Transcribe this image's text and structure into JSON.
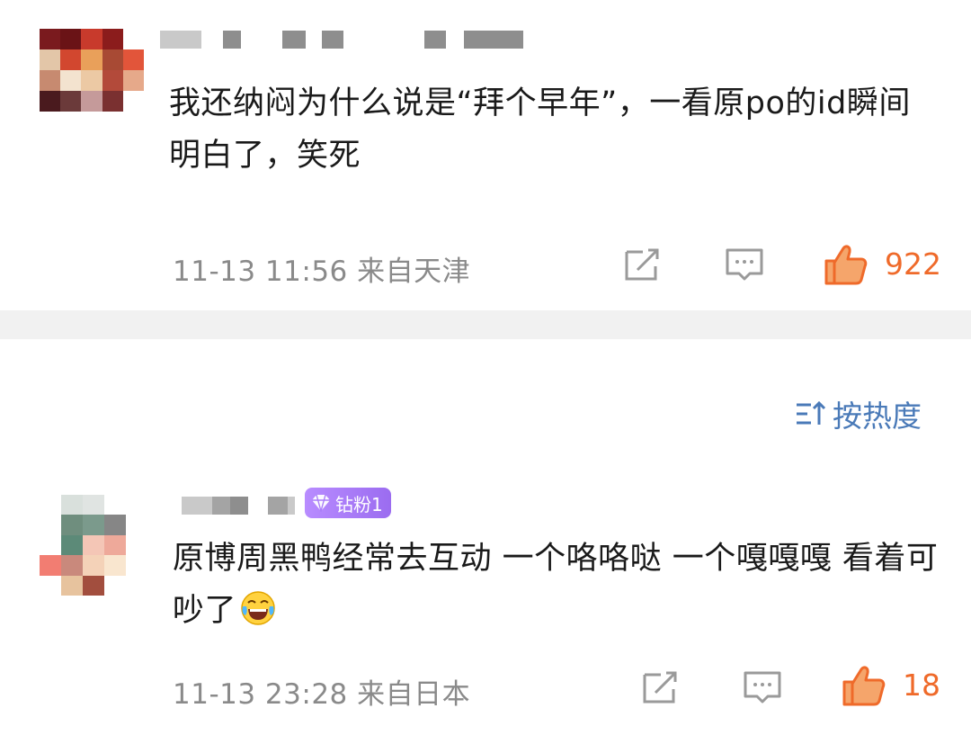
{
  "comments": [
    {
      "text": "我还纳闷为什么说是“拜个早年”，一看原po的id瞬间明白了，笑死",
      "time": "11-13 11:56",
      "location": "来自天津",
      "likes": "922",
      "share_icon": "share-icon",
      "reply_icon": "comment-icon",
      "like_icon": "thumbs-up-icon"
    },
    {
      "badge": "钻粉1",
      "text": "原博周黑鸭经常去互动 一个咯咯哒 一个嘎嘎嘎 看着可吵了",
      "emoji": "laughing-crying-emoji",
      "time": "11-13 23:28",
      "location": "来自日本",
      "likes": "18",
      "share_icon": "share-icon",
      "reply_icon": "comment-icon",
      "like_icon": "thumbs-up-icon"
    }
  ],
  "sort": {
    "label": "按热度",
    "icon": "sort-icon"
  },
  "colors": {
    "like_accent": "#ef6a2a",
    "sort_accent": "#4a7ab8",
    "badge": "#a97cf8",
    "meta_gray": "#8a8a8a",
    "divider": "#f1f1f1"
  }
}
